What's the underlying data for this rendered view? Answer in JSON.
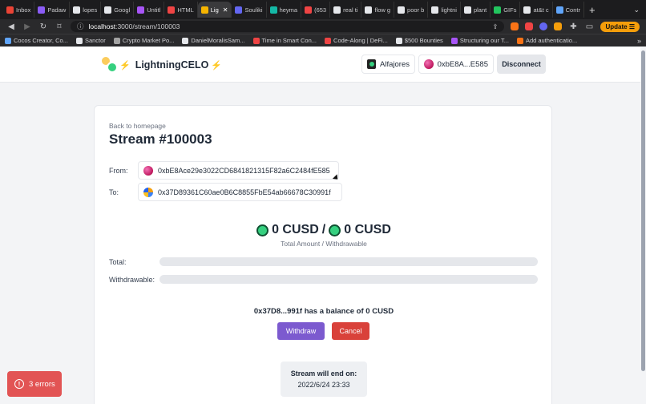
{
  "browser": {
    "tabs": [
      {
        "label": "Inbox",
        "color": "#ea4335"
      },
      {
        "label": "Padaw",
        "color": "#8b5cf6"
      },
      {
        "label": "lopes",
        "color": "#e5e7eb"
      },
      {
        "label": "Googl",
        "color": "#e5e7eb"
      },
      {
        "label": "Untitl",
        "color": "#a855f7"
      },
      {
        "label": "HTML",
        "color": "#ef4444"
      },
      {
        "label": "Lig",
        "color": "#f5b400",
        "active": true
      },
      {
        "label": "Souliki",
        "color": "#6366f1"
      },
      {
        "label": "heyma",
        "color": "#14b8a6"
      },
      {
        "label": "(653",
        "color": "#ef4444"
      },
      {
        "label": "real ti",
        "color": "#e5e7eb"
      },
      {
        "label": "flow g",
        "color": "#e5e7eb"
      },
      {
        "label": "poor b",
        "color": "#e5e7eb"
      },
      {
        "label": "lightni",
        "color": "#e5e7eb"
      },
      {
        "label": "plant",
        "color": "#e5e7eb"
      },
      {
        "label": "GIFs",
        "color": "#22c55e"
      },
      {
        "label": "at&t c",
        "color": "#e5e7eb"
      },
      {
        "label": "Contr",
        "color": "#60a5fa"
      }
    ],
    "new_tab_label": "+",
    "url_host": "localhost",
    "url_path": ":3000/stream/100003",
    "update_label": "Update",
    "bookmarks": [
      {
        "label": "Cocos Creator, Co...",
        "color": "#60a5fa"
      },
      {
        "label": "Sanctor",
        "color": "#e5e7eb"
      },
      {
        "label": "Crypto Market Po...",
        "color": "#a3a3a3"
      },
      {
        "label": "DanielMoralisSam...",
        "color": "#e5e7eb"
      },
      {
        "label": "Time in Smart Con...",
        "color": "#ef4444"
      },
      {
        "label": "Code-Along | DeFi...",
        "color": "#ef4444"
      },
      {
        "label": "$500 Bounties",
        "color": "#e5e7eb"
      },
      {
        "label": "Structuring our T...",
        "color": "#a855f7"
      },
      {
        "label": "Add authenticatio...",
        "color": "#f97316"
      }
    ]
  },
  "header": {
    "brand": "LightningCELO",
    "network": "Alfajores",
    "account": "0xbE8A...E585",
    "disconnect_label": "Disconnect"
  },
  "stream": {
    "back_label": "Back to homepage",
    "title": "Stream #100003",
    "from_label": "From:",
    "from_address": "0xbE8Ace29e3022CD6841821315F82a6C2484fE585",
    "to_label": "To:",
    "to_address": "0x37D89361C60ae0B6C8855FbE54ab66678C30991f",
    "total_amount": "0 CUSD",
    "separator": "/",
    "withdrawable_amount": "0 CUSD",
    "amount_caption": "Total Amount / Withdrawable",
    "total_label": "Total:",
    "withdrawable_label": "Withdrawable:",
    "total_progress": 0,
    "withdrawable_progress": 0,
    "balance_text": "0x37D8...991f has a balance of 0 CUSD",
    "withdraw_label": "Withdraw",
    "cancel_label": "Cancel",
    "end_title": "Stream will end on:",
    "end_date": "2022/6/24 23:33"
  },
  "errors": {
    "label": "3 errors"
  },
  "colors": {
    "accent_purple": "#7c5acf",
    "danger_red": "#d9413a",
    "celo_green": "#35d07f"
  }
}
